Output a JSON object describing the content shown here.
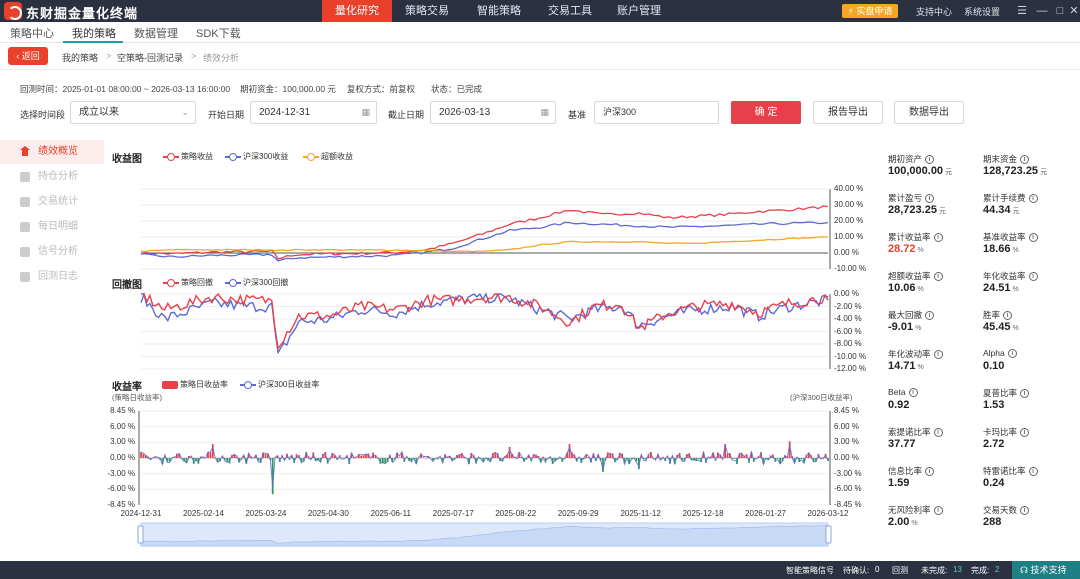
{
  "app": {
    "title": "东财掘金量化终端"
  },
  "topnav": [
    "量化研究",
    "策略交易",
    "智能策略",
    "交易工具",
    "账户管理"
  ],
  "topnav_active": 0,
  "top_right": {
    "trial": "实盘申请",
    "support": "支持中心",
    "settings": "系统设置"
  },
  "window_icons": {
    "menu": "☰",
    "minimize": "—",
    "maximize": "□",
    "close": "✕"
  },
  "tabs": [
    "策略中心",
    "我的策略",
    "数据管理",
    "SDK下载"
  ],
  "tabs_active": 1,
  "breadcrumb": {
    "back": "返回",
    "items": [
      "我的策略",
      "空策略-回测记录",
      "绩效分析"
    ]
  },
  "info": {
    "backtest_time": "回测时间：2025-01-01 08:00:00 ~ 2026-03-13 16:00:00",
    "initial_fund": "期初资金：100,000.00 元",
    "adjust": "复权方式：前复权",
    "state": "状态：已完成"
  },
  "filters": {
    "period_label": "选择时间段",
    "period_value": "成立以来",
    "start_label": "开始日期",
    "start_value": "2024-12-31",
    "end_label": "截止日期",
    "end_value": "2026-03-13",
    "bench_label": "基准",
    "bench_value": "沪深300",
    "confirm": "确 定",
    "export_report": "报告导出",
    "export_data": "数据导出"
  },
  "sidebar": [
    {
      "label": "绩效概览",
      "active": true
    },
    {
      "label": "持仓分析",
      "active": false
    },
    {
      "label": "交易统计",
      "active": false
    },
    {
      "label": "每日明细",
      "active": false
    },
    {
      "label": "信号分析",
      "active": false
    },
    {
      "label": "回测日志",
      "active": false
    }
  ],
  "stats": [
    {
      "label": "期初资产",
      "value": "100,000.00",
      "unit": "元",
      "red": false
    },
    {
      "label": "期末资金",
      "value": "128,723.25",
      "unit": "元",
      "red": false
    },
    {
      "label": "累计盈亏",
      "value": "28,723.25",
      "unit": "元",
      "red": false
    },
    {
      "label": "累计手续费",
      "value": "44.34",
      "unit": "元",
      "red": false
    },
    {
      "label": "累计收益率",
      "value": "28.72",
      "unit": "%",
      "red": true
    },
    {
      "label": "基准收益率",
      "value": "18.66",
      "unit": "%",
      "red": false
    },
    {
      "label": "超额收益率",
      "value": "10.06",
      "unit": "%",
      "red": false
    },
    {
      "label": "年化收益率",
      "value": "24.51",
      "unit": "%",
      "red": false
    },
    {
      "label": "最大回撤",
      "value": "-9.01",
      "unit": "%",
      "red": false
    },
    {
      "label": "胜率",
      "value": "45.45",
      "unit": "%",
      "red": false
    },
    {
      "label": "年化波动率",
      "value": "14.71",
      "unit": "%",
      "red": false
    },
    {
      "label": "Alpha",
      "value": "0.10",
      "unit": "",
      "red": false
    },
    {
      "label": "Beta",
      "value": "0.92",
      "unit": "",
      "red": false
    },
    {
      "label": "夏普比率",
      "value": "1.53",
      "unit": "",
      "red": false
    },
    {
      "label": "索提诺比率",
      "value": "37.77",
      "unit": "",
      "red": false
    },
    {
      "label": "卡玛比率",
      "value": "2.72",
      "unit": "",
      "red": false
    },
    {
      "label": "信息比率",
      "value": "1.59",
      "unit": "",
      "red": false
    },
    {
      "label": "特雷诺比率",
      "value": "0.24",
      "unit": "",
      "red": false
    },
    {
      "label": "无风险利率",
      "value": "2.00",
      "unit": "%",
      "red": false
    },
    {
      "label": "交易天数",
      "value": "288",
      "unit": "",
      "red": false
    }
  ],
  "status": {
    "signal_label": "智能策略信号",
    "pending_label": "待确认:",
    "pending_value": "0",
    "backtest_label": "回测",
    "unfinished_label": "未完成:",
    "unfinished_value": "13",
    "finished_label": "完成:",
    "finished_value": "2",
    "support": "技术支持"
  },
  "colors": {
    "strategy": "#e8404a",
    "benchmark": "#5b6bd6",
    "excess": "#f5a623",
    "accent": "#e8402a",
    "teal": "#1aa1a8",
    "neg": "#2e9a5e"
  },
  "chart_data": [
    {
      "type": "line",
      "title": "收益图",
      "series": [
        {
          "name": "策略收益",
          "color": "#e8404a",
          "x": [
            "2024-12-31",
            "2025-01-20",
            "2025-02-14",
            "2025-03-10",
            "2025-03-24",
            "2025-03-28",
            "2025-04-08",
            "2025-04-30",
            "2025-05-20",
            "2025-06-11",
            "2025-06-30",
            "2025-07-17",
            "2025-08-05",
            "2025-08-22",
            "2025-09-10",
            "2025-09-29",
            "2025-10-20",
            "2025-11-12",
            "2025-12-01",
            "2025-12-18",
            "2026-01-05",
            "2026-01-27",
            "2026-02-15",
            "2026-03-12"
          ],
          "values": [
            0.0,
            -0.5,
            0.5,
            0.8,
            1.0,
            -3.5,
            -1.0,
            -0.5,
            -0.2,
            0.3,
            2.0,
            6.0,
            12.0,
            18.0,
            22.0,
            27.0,
            24.0,
            25.0,
            22.0,
            23.0,
            24.0,
            26.0,
            27.0,
            29.0
          ]
        },
        {
          "name": "沪深300收益",
          "color": "#5b6bd6",
          "x": [
            "2024-12-31",
            "2025-01-20",
            "2025-02-14",
            "2025-03-10",
            "2025-03-24",
            "2025-03-28",
            "2025-04-08",
            "2025-04-30",
            "2025-05-20",
            "2025-06-11",
            "2025-06-30",
            "2025-07-17",
            "2025-08-05",
            "2025-08-22",
            "2025-09-10",
            "2025-09-29",
            "2025-10-20",
            "2025-11-12",
            "2025-12-01",
            "2025-12-18",
            "2026-01-05",
            "2026-01-27",
            "2026-02-15",
            "2026-03-12"
          ],
          "values": [
            -1.0,
            -2.5,
            -1.5,
            -1.2,
            -1.0,
            -5.0,
            -3.0,
            -2.5,
            -2.0,
            -1.5,
            0.5,
            3.0,
            9.0,
            14.0,
            16.0,
            19.0,
            18.0,
            17.0,
            16.0,
            16.5,
            17.0,
            18.0,
            18.5,
            19.0
          ]
        },
        {
          "name": "超额收益",
          "color": "#f5a623",
          "x": [
            "2024-12-31",
            "2025-01-20",
            "2025-02-14",
            "2025-03-10",
            "2025-03-24",
            "2025-03-28",
            "2025-04-08",
            "2025-04-30",
            "2025-05-20",
            "2025-06-11",
            "2025-06-30",
            "2025-07-17",
            "2025-08-05",
            "2025-08-22",
            "2025-09-10",
            "2025-09-29",
            "2025-10-20",
            "2025-11-12",
            "2025-12-01",
            "2025-12-18",
            "2026-01-05",
            "2026-01-27",
            "2026-02-15",
            "2026-03-12"
          ],
          "values": [
            1.0,
            2.0,
            2.0,
            2.0,
            2.0,
            1.5,
            2.0,
            2.0,
            1.8,
            1.8,
            1.5,
            1.0,
            1.0,
            2.0,
            5.0,
            7.0,
            7.0,
            7.0,
            6.0,
            6.0,
            7.0,
            8.0,
            9.0,
            10.0
          ]
        }
      ],
      "yticks": [
        "40.00 %",
        "30.00 %",
        "20.00 %",
        "10.00 %",
        "0.00 %",
        "-10.00 %"
      ],
      "ylim": [
        -10,
        40
      ]
    },
    {
      "type": "line",
      "title": "回撤图",
      "series": [
        {
          "name": "策略回撤",
          "color": "#e8404a",
          "x": [
            "2024-12-31",
            "2025-01-15",
            "2025-02-14",
            "2025-03-10",
            "2025-03-24",
            "2025-03-28",
            "2025-04-10",
            "2025-04-30",
            "2025-05-20",
            "2025-06-11",
            "2025-07-01",
            "2025-07-17",
            "2025-08-05",
            "2025-08-22",
            "2025-09-10",
            "2025-09-29",
            "2025-10-15",
            "2025-11-01",
            "2025-11-12",
            "2025-12-01",
            "2025-12-18",
            "2026-01-10",
            "2026-01-27",
            "2026-02-15",
            "2026-03-12"
          ],
          "values": [
            0.0,
            -2.5,
            -0.5,
            -1.0,
            -1.0,
            -8.0,
            -3.5,
            -3.5,
            -2.0,
            -2.5,
            -1.0,
            -1.0,
            -0.5,
            -0.5,
            -2.0,
            -4.5,
            -2.0,
            -1.5,
            -5.5,
            -3.0,
            -2.0,
            -1.5,
            -3.0,
            -1.5,
            -0.5
          ]
        },
        {
          "name": "沪深300回撤",
          "color": "#5b6bd6",
          "x": [
            "2024-12-31",
            "2025-01-15",
            "2025-02-14",
            "2025-03-10",
            "2025-03-24",
            "2025-03-28",
            "2025-04-10",
            "2025-04-30",
            "2025-05-20",
            "2025-06-11",
            "2025-07-01",
            "2025-07-17",
            "2025-08-05",
            "2025-08-22",
            "2025-09-10",
            "2025-09-29",
            "2025-10-15",
            "2025-11-01",
            "2025-11-12",
            "2025-12-01",
            "2025-12-18",
            "2026-01-10",
            "2026-01-27",
            "2026-02-15",
            "2026-03-12"
          ],
          "values": [
            -0.5,
            -4.0,
            -1.5,
            -2.0,
            -2.0,
            -10.0,
            -4.5,
            -4.0,
            -2.5,
            -3.0,
            -1.5,
            -1.0,
            -0.5,
            -0.8,
            -2.5,
            -4.0,
            -2.5,
            -2.0,
            -5.0,
            -3.5,
            -2.5,
            -2.0,
            -3.5,
            -2.0,
            -1.0
          ]
        }
      ],
      "yticks": [
        "0.00 %",
        "-2.00 %",
        "-4.00 %",
        "-6.00 %",
        "-8.00 %",
        "-10.00 %",
        "-12.00 %"
      ],
      "ylim": [
        -12,
        0
      ]
    },
    {
      "type": "bar",
      "title": "收益率",
      "left_axis_label": "(策略日收益率)",
      "right_axis_label": "(沪深300日收益率)",
      "series": [
        {
          "name": "策略日收益率",
          "color": "#e8404a"
        },
        {
          "name": "沪深300日收益率",
          "color": "#5b6bd6"
        }
      ],
      "yticks": [
        "8.45 %",
        "6.00 %",
        "3.00 %",
        "0.00 %",
        "-3.00 %",
        "-6.00 %",
        "-8.45 %"
      ],
      "ylim": [
        -8.45,
        8.45
      ],
      "xticks": [
        "2024-12-31",
        "2025-02-14",
        "2025-03-24",
        "2025-04-30",
        "2025-06-11",
        "2025-07-17",
        "2025-08-22",
        "2025-09-29",
        "2025-11-12",
        "2025-12-18",
        "2026-01-27",
        "2026-03-12"
      ],
      "notable_days": [
        {
          "x": "2025-02-14",
          "value": 2.5
        },
        {
          "x": "2025-03-24",
          "value": -6.5
        },
        {
          "x": "2025-08-22",
          "value": 2.0
        },
        {
          "x": "2025-09-29",
          "value": 2.5
        },
        {
          "x": "2025-10-20",
          "value": -2.5
        },
        {
          "x": "2025-11-12",
          "value": -2.0
        },
        {
          "x": "2026-01-05",
          "value": 2.5
        },
        {
          "x": "2026-02-15",
          "value": 3.0
        }
      ]
    }
  ]
}
